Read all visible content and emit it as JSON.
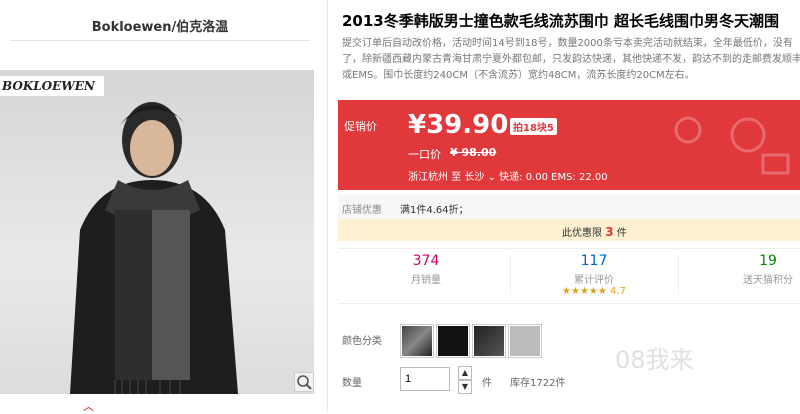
{
  "shop": {
    "title": "Bokloewen/伯克洛温"
  },
  "gallery": {
    "brand_logo": "BOKLOEWEN",
    "zoom_icon": "zoom-icon"
  },
  "product": {
    "title": "2013冬季韩版男士撞色款毛线流苏围巾 超长毛线围巾男冬天潮围",
    "description": "提交订单后自动改价格，活动时间14号到18号，数量2000条亏本卖完活动就结束，全年最低价，没有了，除新疆西藏内蒙古青海甘肃宁夏外都包邮，只发韵达快递，其他快递不发，韵达不到的走邮费发顺丰或EMS。围巾长度约240CM（不含流苏）宽约48CM，流苏长度约20CM左右。"
  },
  "price": {
    "promo_label": "促销价",
    "current": "¥39.90",
    "discount_badge": "拍18块5",
    "orig_label": "一口价",
    "orig_value": "¥ 98.00",
    "ship_from": "浙江杭州",
    "ship_to_label": "至",
    "ship_to": "长沙",
    "ship_info": "快递: 0.00 EMS: 22.00"
  },
  "shop_deal": {
    "label": "店铺优惠",
    "value": "满1件4.64折；"
  },
  "limit": {
    "prefix": "此优惠限",
    "count": "3",
    "suffix": "件"
  },
  "stats": {
    "monthly_sales": "374",
    "monthly_label": "月销量",
    "reviews": "117",
    "reviews_label": "累计评价",
    "rating": "4.7",
    "points": "19",
    "points_label": "送天猫积分"
  },
  "options": {
    "color_label": "颜色分类"
  },
  "quantity": {
    "label": "数量",
    "value": "1",
    "unit": "件",
    "stock": "库存1722件"
  },
  "watermark": "08我来",
  "colors": {
    "accent": "#e0383b",
    "limit_bg": "#fdf1d1"
  }
}
